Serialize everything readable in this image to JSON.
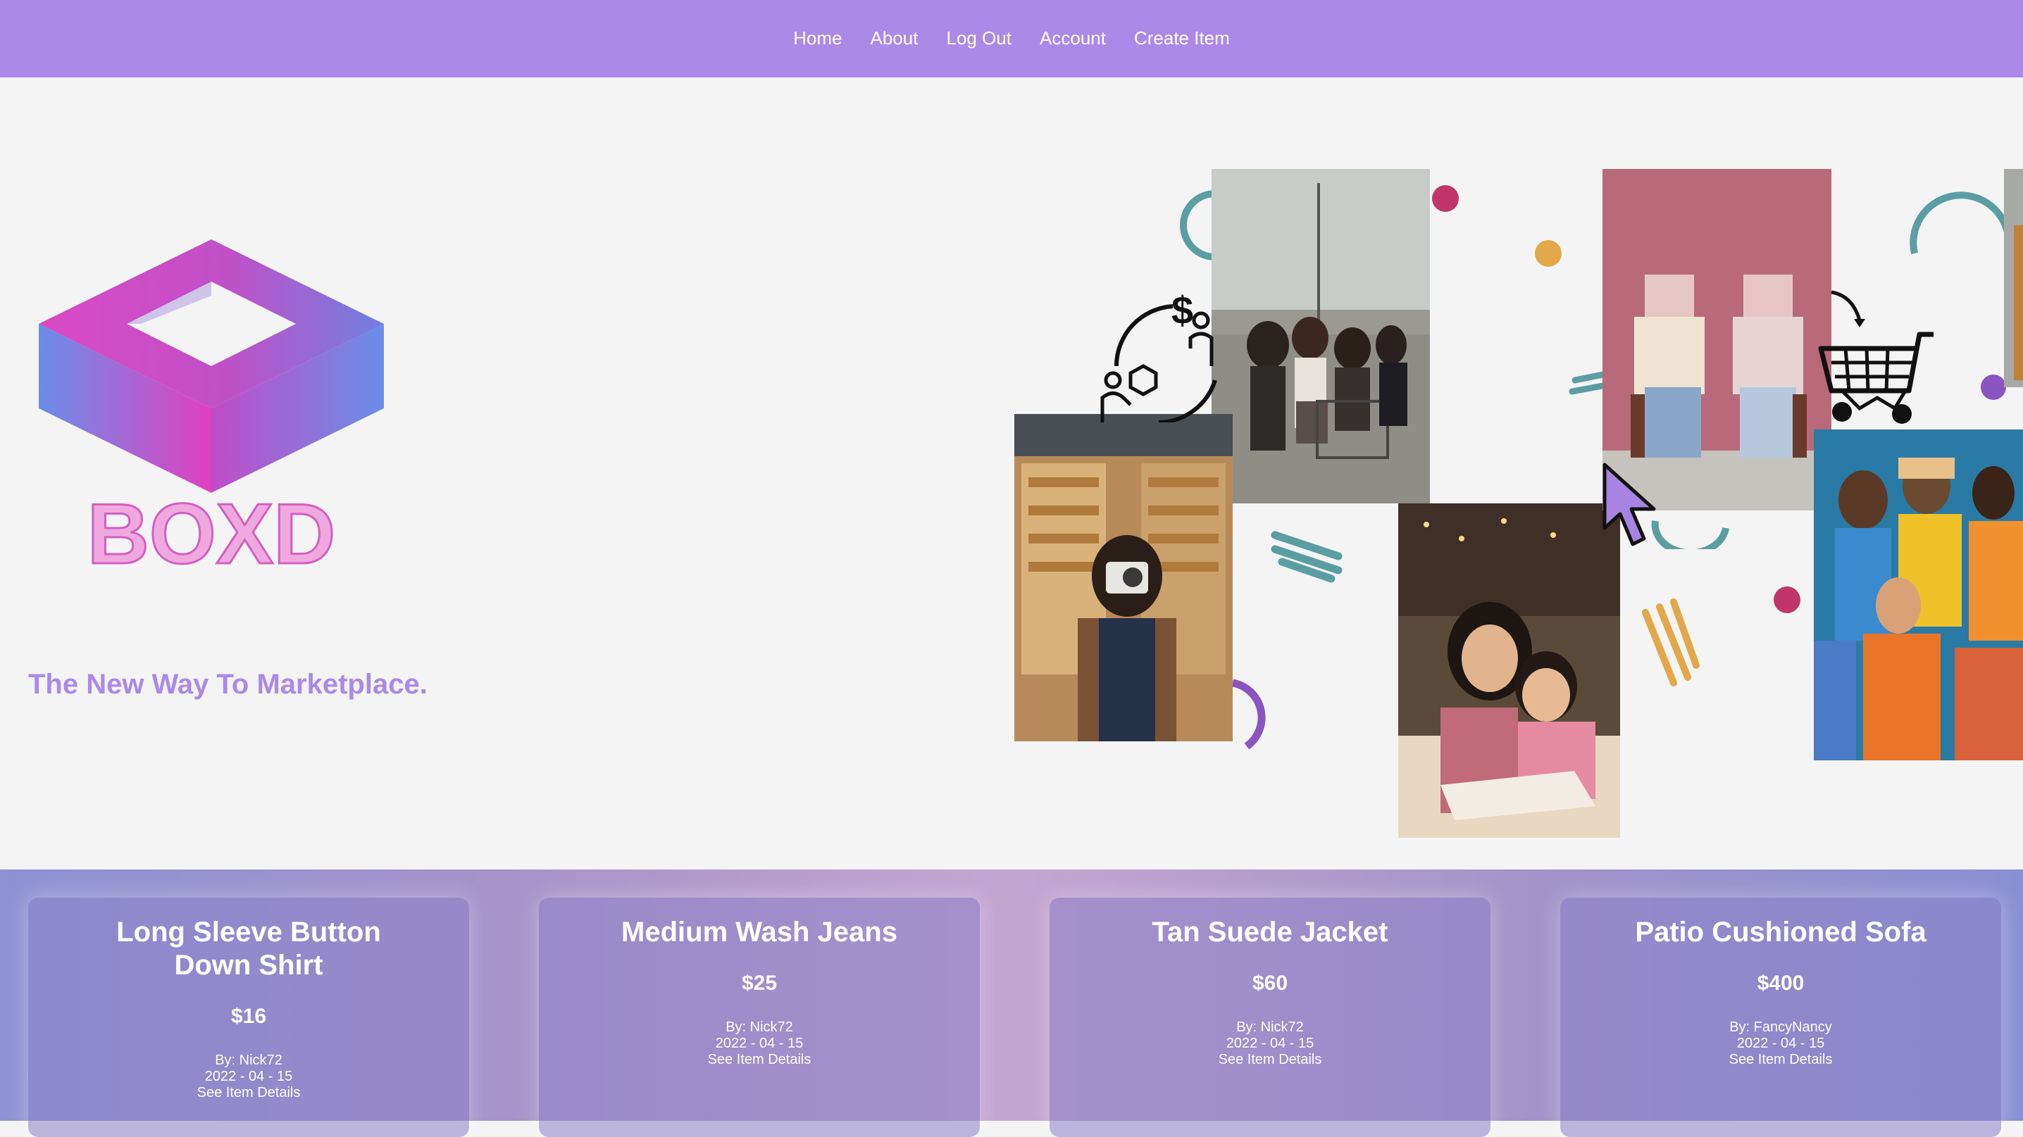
{
  "nav": {
    "items": [
      {
        "label": "Home"
      },
      {
        "label": "About"
      },
      {
        "label": "Log Out"
      },
      {
        "label": "Account"
      },
      {
        "label": "Create Item"
      }
    ]
  },
  "brand": {
    "name": "BOXD",
    "tagline": "The New Way To Marketplace."
  },
  "colors": {
    "nav_bg": "#ab89e8",
    "accent": "#ab89e8",
    "logo_pink": "#e040c0",
    "logo_blue": "#6a8ee8",
    "deco_teal": "#5a9ea2",
    "deco_red": "#c0356a",
    "deco_gold": "#e2a84a",
    "deco_purple": "#8a55c0"
  },
  "icons": [
    "shopping-cart-icon",
    "cursor-arrow-icon",
    "exchange-icon"
  ],
  "products": [
    {
      "title": "Long Sleeve Button Down Shirt",
      "price": "$16",
      "by": "By: Nick72",
      "date": "2022 - 04 - 15",
      "details": "See Item Details"
    },
    {
      "title": "Medium Wash Jeans",
      "price": "$25",
      "by": "By: Nick72",
      "date": "2022 - 04 - 15",
      "details": "See Item Details"
    },
    {
      "title": "Tan Suede Jacket",
      "price": "$60",
      "by": "By: Nick72",
      "date": "2022 - 04 - 15",
      "details": "See Item Details"
    },
    {
      "title": "Patio Cushioned Sofa",
      "price": "$400",
      "by": "By: FancyNancy",
      "date": "2022 - 04 - 15",
      "details": "See Item Details"
    }
  ]
}
